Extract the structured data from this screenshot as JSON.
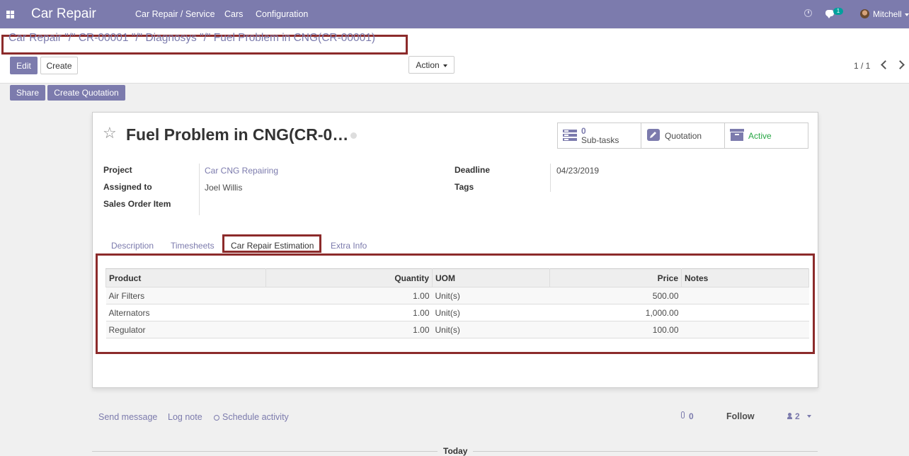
{
  "navbar": {
    "app_title": "Car Repair",
    "menus": [
      "Car Repair / Service",
      "Cars",
      "Configuration"
    ],
    "chat_badge": "1",
    "user_name": "Mitchell"
  },
  "control_panel": {
    "breadcrumb": "Car Repair \"/\" CR-00001 \"/\" Diagnosys \"/\" Fuel Problem in CNG(CR-00001)",
    "edit_label": "Edit",
    "create_label": "Create",
    "action_label": "Action",
    "pager": "1 / 1",
    "share_label": "Share",
    "create_quotation_label": "Create Quotation"
  },
  "record": {
    "title": "Fuel Problem in CNG(CR-0…",
    "smart_buttons": {
      "subtasks_count": "0",
      "subtasks_label": "Sub-tasks",
      "quotation_label": "Quotation",
      "active_label": "Active"
    },
    "fields": {
      "project_label": "Project",
      "project_value": "Car CNG Repairing",
      "assigned_label": "Assigned to",
      "assigned_value": "Joel Willis",
      "sale_line_label": "Sales Order Item",
      "deadline_label": "Deadline",
      "deadline_value": "04/23/2019",
      "tags_label": "Tags"
    },
    "tabs": [
      "Description",
      "Timesheets",
      "Car Repair Estimation",
      "Extra Info"
    ],
    "table": {
      "headers": [
        "Product",
        "Quantity",
        "UOM",
        "Price",
        "Notes"
      ],
      "rows": [
        {
          "product": "Air Filters",
          "quantity": "1.00",
          "uom": "Unit(s)",
          "price": "500.00",
          "notes": ""
        },
        {
          "product": "Alternators",
          "quantity": "1.00",
          "uom": "Unit(s)",
          "price": "1,000.00",
          "notes": ""
        },
        {
          "product": "Regulator",
          "quantity": "1.00",
          "uom": "Unit(s)",
          "price": "100.00",
          "notes": ""
        }
      ]
    }
  },
  "chatter": {
    "send_message": "Send message",
    "log_note": "Log note",
    "schedule_activity": "Schedule activity",
    "attachments_count": "0",
    "follow_label": "Follow",
    "followers_count": "2",
    "today_label": "Today"
  },
  "colors": {
    "brand": "#7c7bad",
    "highlight_border": "#8c2b2b",
    "active_status": "#28a745"
  }
}
